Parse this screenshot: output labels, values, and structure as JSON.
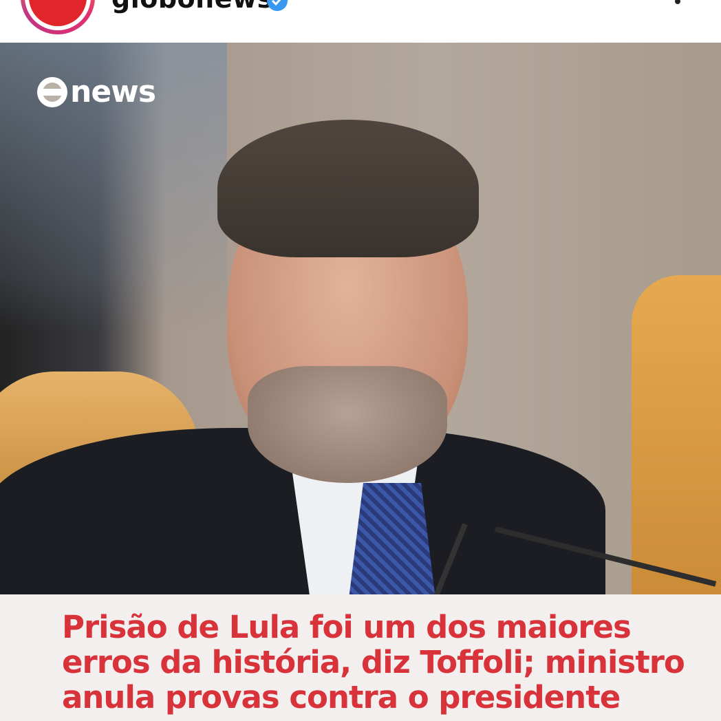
{
  "header": {
    "username": "globonews",
    "verified": true,
    "more_icon": "more-options-icon"
  },
  "post": {
    "logo_text": "news",
    "headline": "Prisão de Lula foi um dos maiores erros da história, diz Toffoli; ministro anula provas contra o presidente",
    "headline_color": "#d8333a",
    "caption_bg": "#f2efee"
  }
}
